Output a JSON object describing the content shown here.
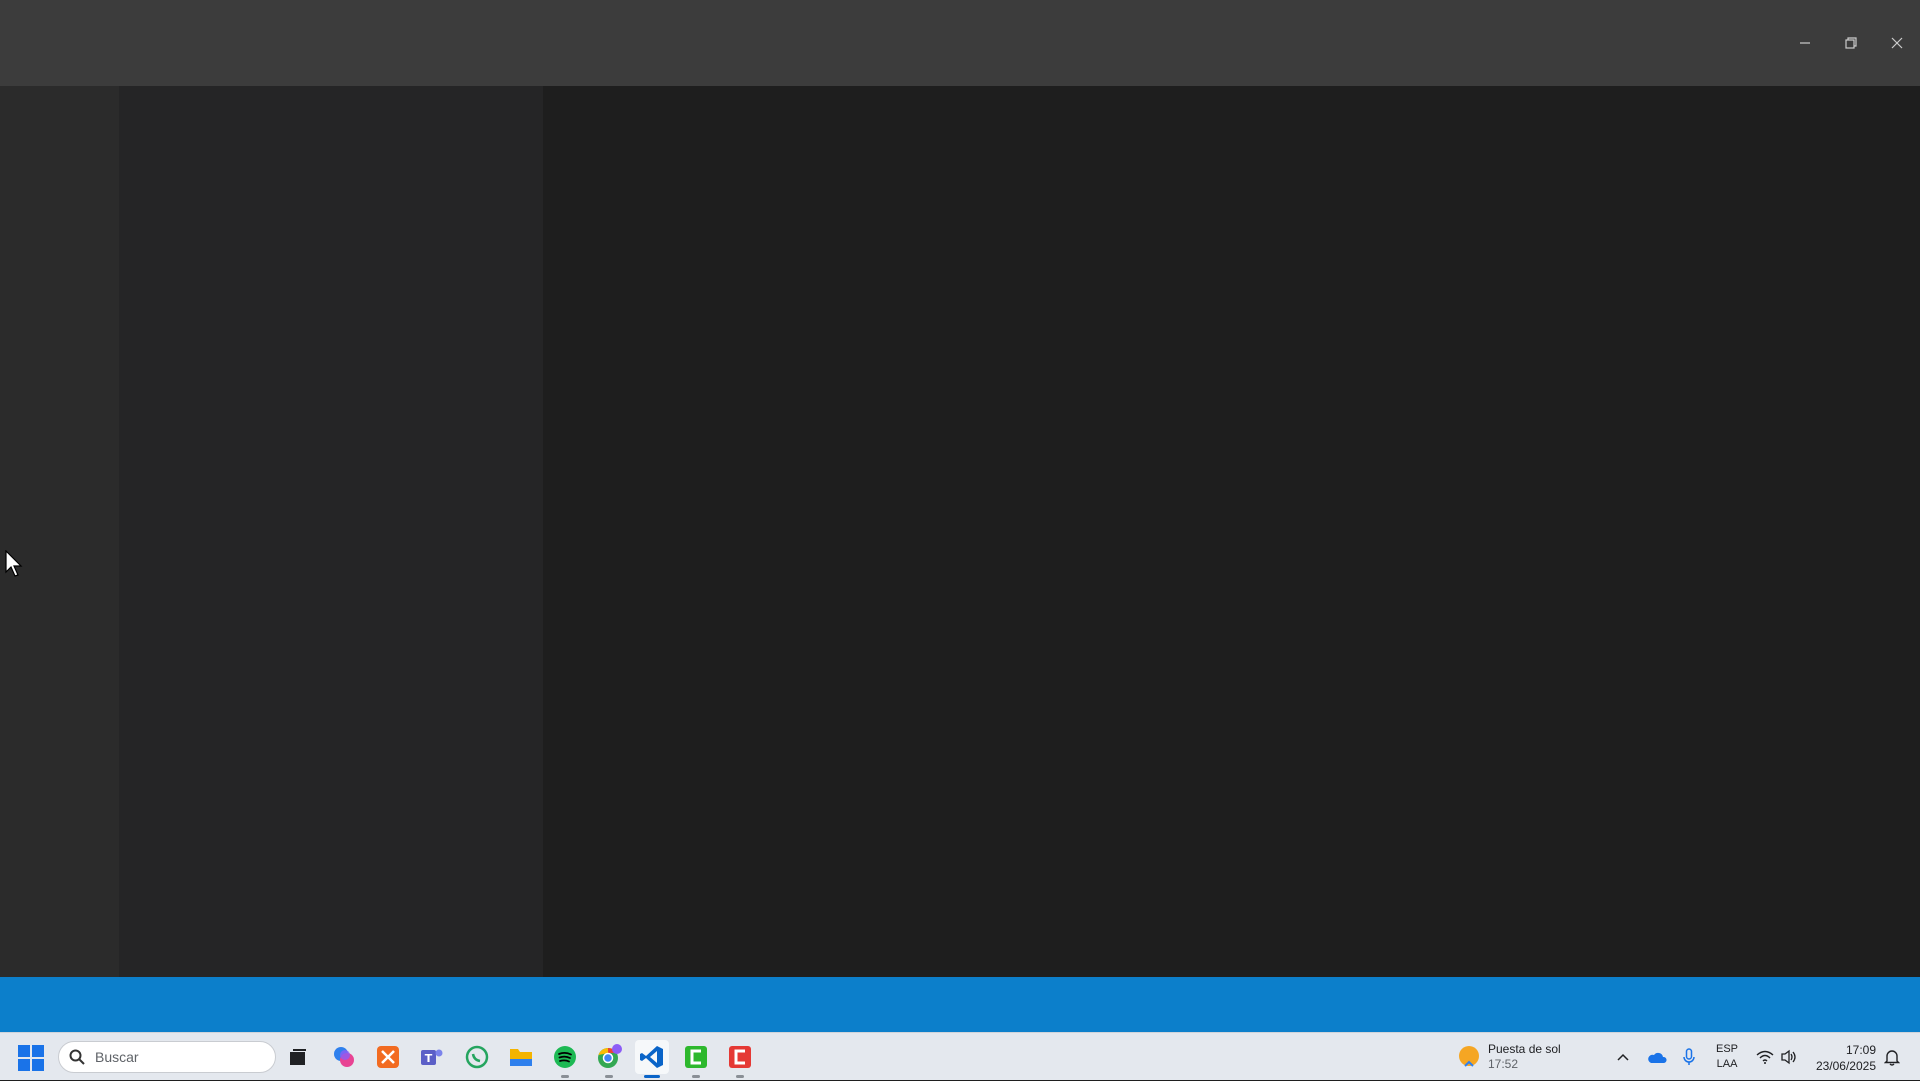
{
  "window": {
    "controls": [
      "minimize",
      "restore",
      "close"
    ]
  },
  "taskbar": {
    "search_placeholder": "Buscar",
    "apps": [
      {
        "name": "task-view",
        "color": "#202124"
      },
      {
        "name": "copilot",
        "color": "#8c5cf6"
      },
      {
        "name": "xampp",
        "color": "#f26b21"
      },
      {
        "name": "teams",
        "color": "#5b5fc7"
      },
      {
        "name": "whatsapp",
        "color": "#25d366"
      },
      {
        "name": "file-explorer",
        "color": "#f4b400"
      },
      {
        "name": "spotify",
        "color": "#1db954"
      },
      {
        "name": "chrome",
        "color": "#4285f4"
      },
      {
        "name": "vscode",
        "color": "#0a64c8"
      },
      {
        "name": "camtasia-green",
        "color": "#2db82d"
      },
      {
        "name": "camtasia-red",
        "color": "#e53935"
      }
    ],
    "weather": {
      "label": "Puesta de sol",
      "time": "17:52"
    },
    "language": {
      "line1": "ESP",
      "line2": "LAA"
    },
    "clock": {
      "time": "17:09",
      "date": "23/06/2025"
    }
  },
  "colors": {
    "titlebar": "#3c3c3c",
    "activitybar": "#2b2b2b",
    "sidebar": "#252526",
    "editor": "#1e1e1e",
    "statusbar": "#0c7fcb",
    "taskbar": "#e4e8ee"
  }
}
